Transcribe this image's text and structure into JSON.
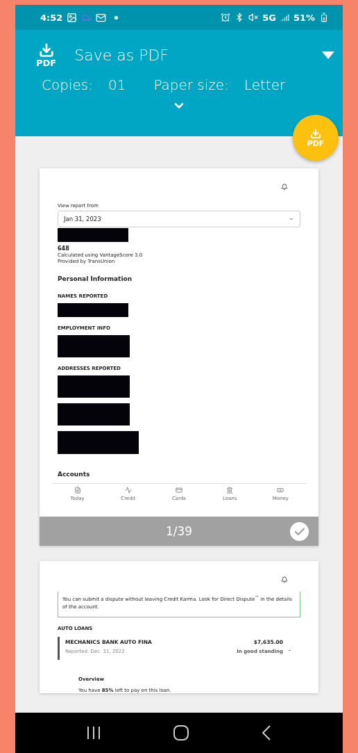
{
  "status_bar": {
    "time": "4:52",
    "network": "5G",
    "battery": "51%"
  },
  "header": {
    "icon_label": "PDF",
    "title": "Save as PDF",
    "copies_label": "Copies:",
    "copies": "01",
    "paper_label": "Paper size:",
    "paper": "Letter"
  },
  "fab": {
    "label": "PDF"
  },
  "pages": [
    {
      "counter": "1/39",
      "selected": true,
      "blocks": [
        {
          "kind": "label",
          "text": "View report from"
        },
        {
          "kind": "select",
          "text": "Jan 31, 2023"
        },
        {
          "kind": "redacted"
        },
        {
          "kind": "score",
          "text": "648"
        },
        {
          "kind": "text",
          "text": "Calculated using VantageScore 3.0"
        },
        {
          "kind": "text",
          "text": "Provided by TransUnion"
        },
        {
          "kind": "heading",
          "text": "Personal Information"
        },
        {
          "kind": "caps",
          "text": "NAMES REPORTED"
        },
        {
          "kind": "redacted"
        },
        {
          "kind": "caps",
          "text": "EMPLOYMENT INFO"
        },
        {
          "kind": "redacted"
        },
        {
          "kind": "caps",
          "text": "ADDRESSES REPORTED"
        },
        {
          "kind": "redacted"
        },
        {
          "kind": "redacted"
        },
        {
          "kind": "redacted"
        },
        {
          "kind": "heading",
          "text": "Accounts"
        }
      ],
      "nav": [
        "Today",
        "Credit",
        "Cards",
        "Loans",
        "Money"
      ]
    },
    {
      "blocks": [
        {
          "kind": "notice",
          "text": "You can submit a dispute without leaving Credit Karma. Look for Direct Dispute$^{™}$ in the details of the account."
        },
        {
          "kind": "caps",
          "text": "AUTO LOANS"
        },
        {
          "kind": "account",
          "name": "MECHANICS BANK AUTO FINA",
          "reported": "Reported: Dec. 31, 2022",
          "amount": "$7,635.00",
          "standing": "In good standing"
        },
        {
          "kind": "overview",
          "title": "Overview",
          "text": "You have **85%** left to pay on this loan."
        }
      ]
    }
  ]
}
